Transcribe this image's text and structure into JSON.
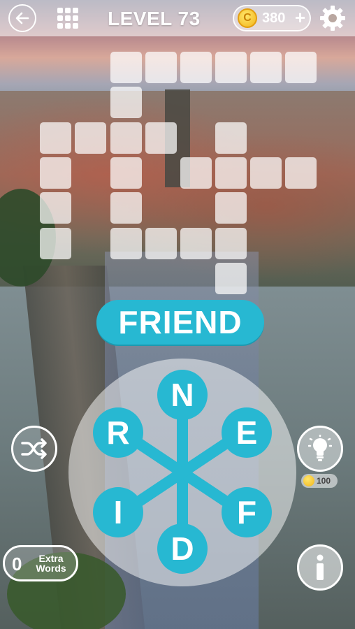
{
  "header": {
    "level_label": "LEVEL 73",
    "coins": "380",
    "coin_symbol": "C",
    "plus": "+"
  },
  "icons": {
    "back": "back-arrow-icon",
    "menu": "grid-menu-icon",
    "coin": "coin-icon",
    "settings": "gear-icon",
    "shuffle": "shuffle-icon",
    "hint": "lightbulb-icon",
    "info": "info-icon"
  },
  "found_word": "FRIEND",
  "wheel": {
    "letters": [
      "N",
      "E",
      "F",
      "D",
      "I",
      "R"
    ]
  },
  "hint_cost": "100",
  "extra_words": {
    "count": "0",
    "label": "Extra Words"
  },
  "colors": {
    "accent": "#27b8d2",
    "coin": "#f2b51c",
    "tile": "#ffffff"
  }
}
